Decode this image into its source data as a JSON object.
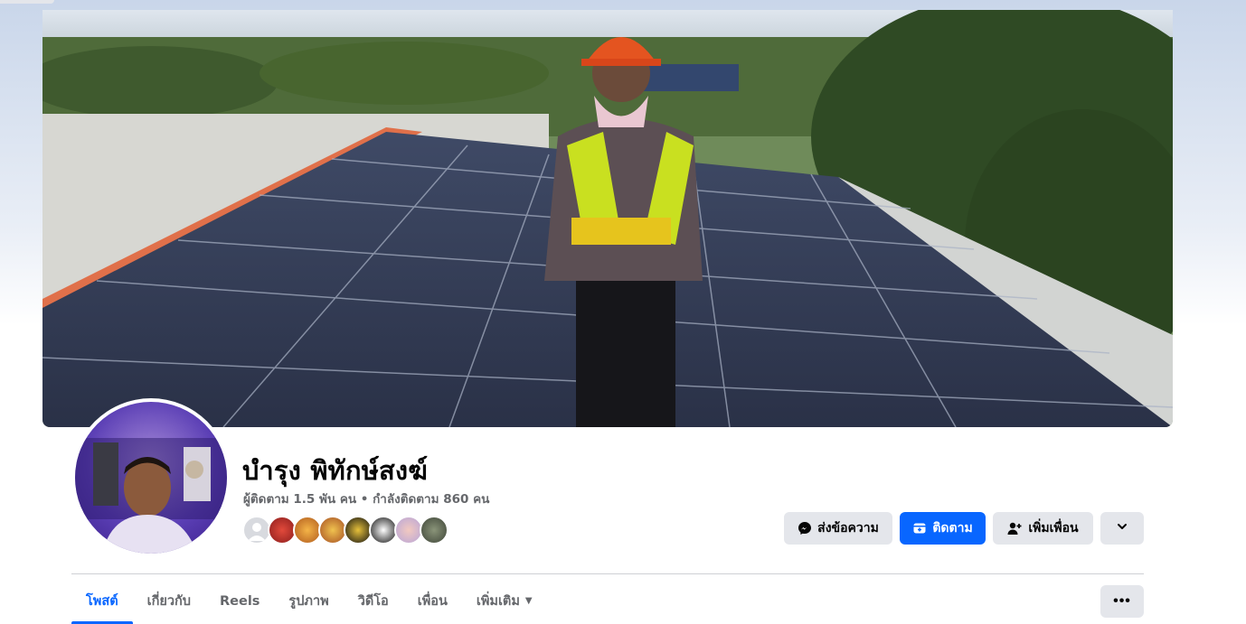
{
  "profile": {
    "name": "บำรุง พิทักษ์สงฆ์",
    "stats": "ผู้ติดตาม 1.5 พัน คน • กำลังติดตาม 860 คน"
  },
  "actions": {
    "message_label": "ส่งข้อความ",
    "follow_label": "ติดตาม",
    "add_friend_label": "เพิ่มเพื่อน"
  },
  "tabs": [
    {
      "label": "โพสต์",
      "active": true
    },
    {
      "label": "เกี่ยวกับ"
    },
    {
      "label": "Reels"
    },
    {
      "label": "รูปภาพ"
    },
    {
      "label": "วิดีโอ"
    },
    {
      "label": "เพื่อน"
    },
    {
      "label": "เพิ่มเติม"
    }
  ],
  "icons": {
    "message": "messenger-icon",
    "follow": "follow-icon",
    "add_friend": "add-friend-icon",
    "more": "chevron-down-icon",
    "tab_more": "ellipsis-icon"
  },
  "colors": {
    "accent": "#0866ff",
    "secondary_button": "#e4e6eb",
    "muted_text": "#65676b"
  }
}
